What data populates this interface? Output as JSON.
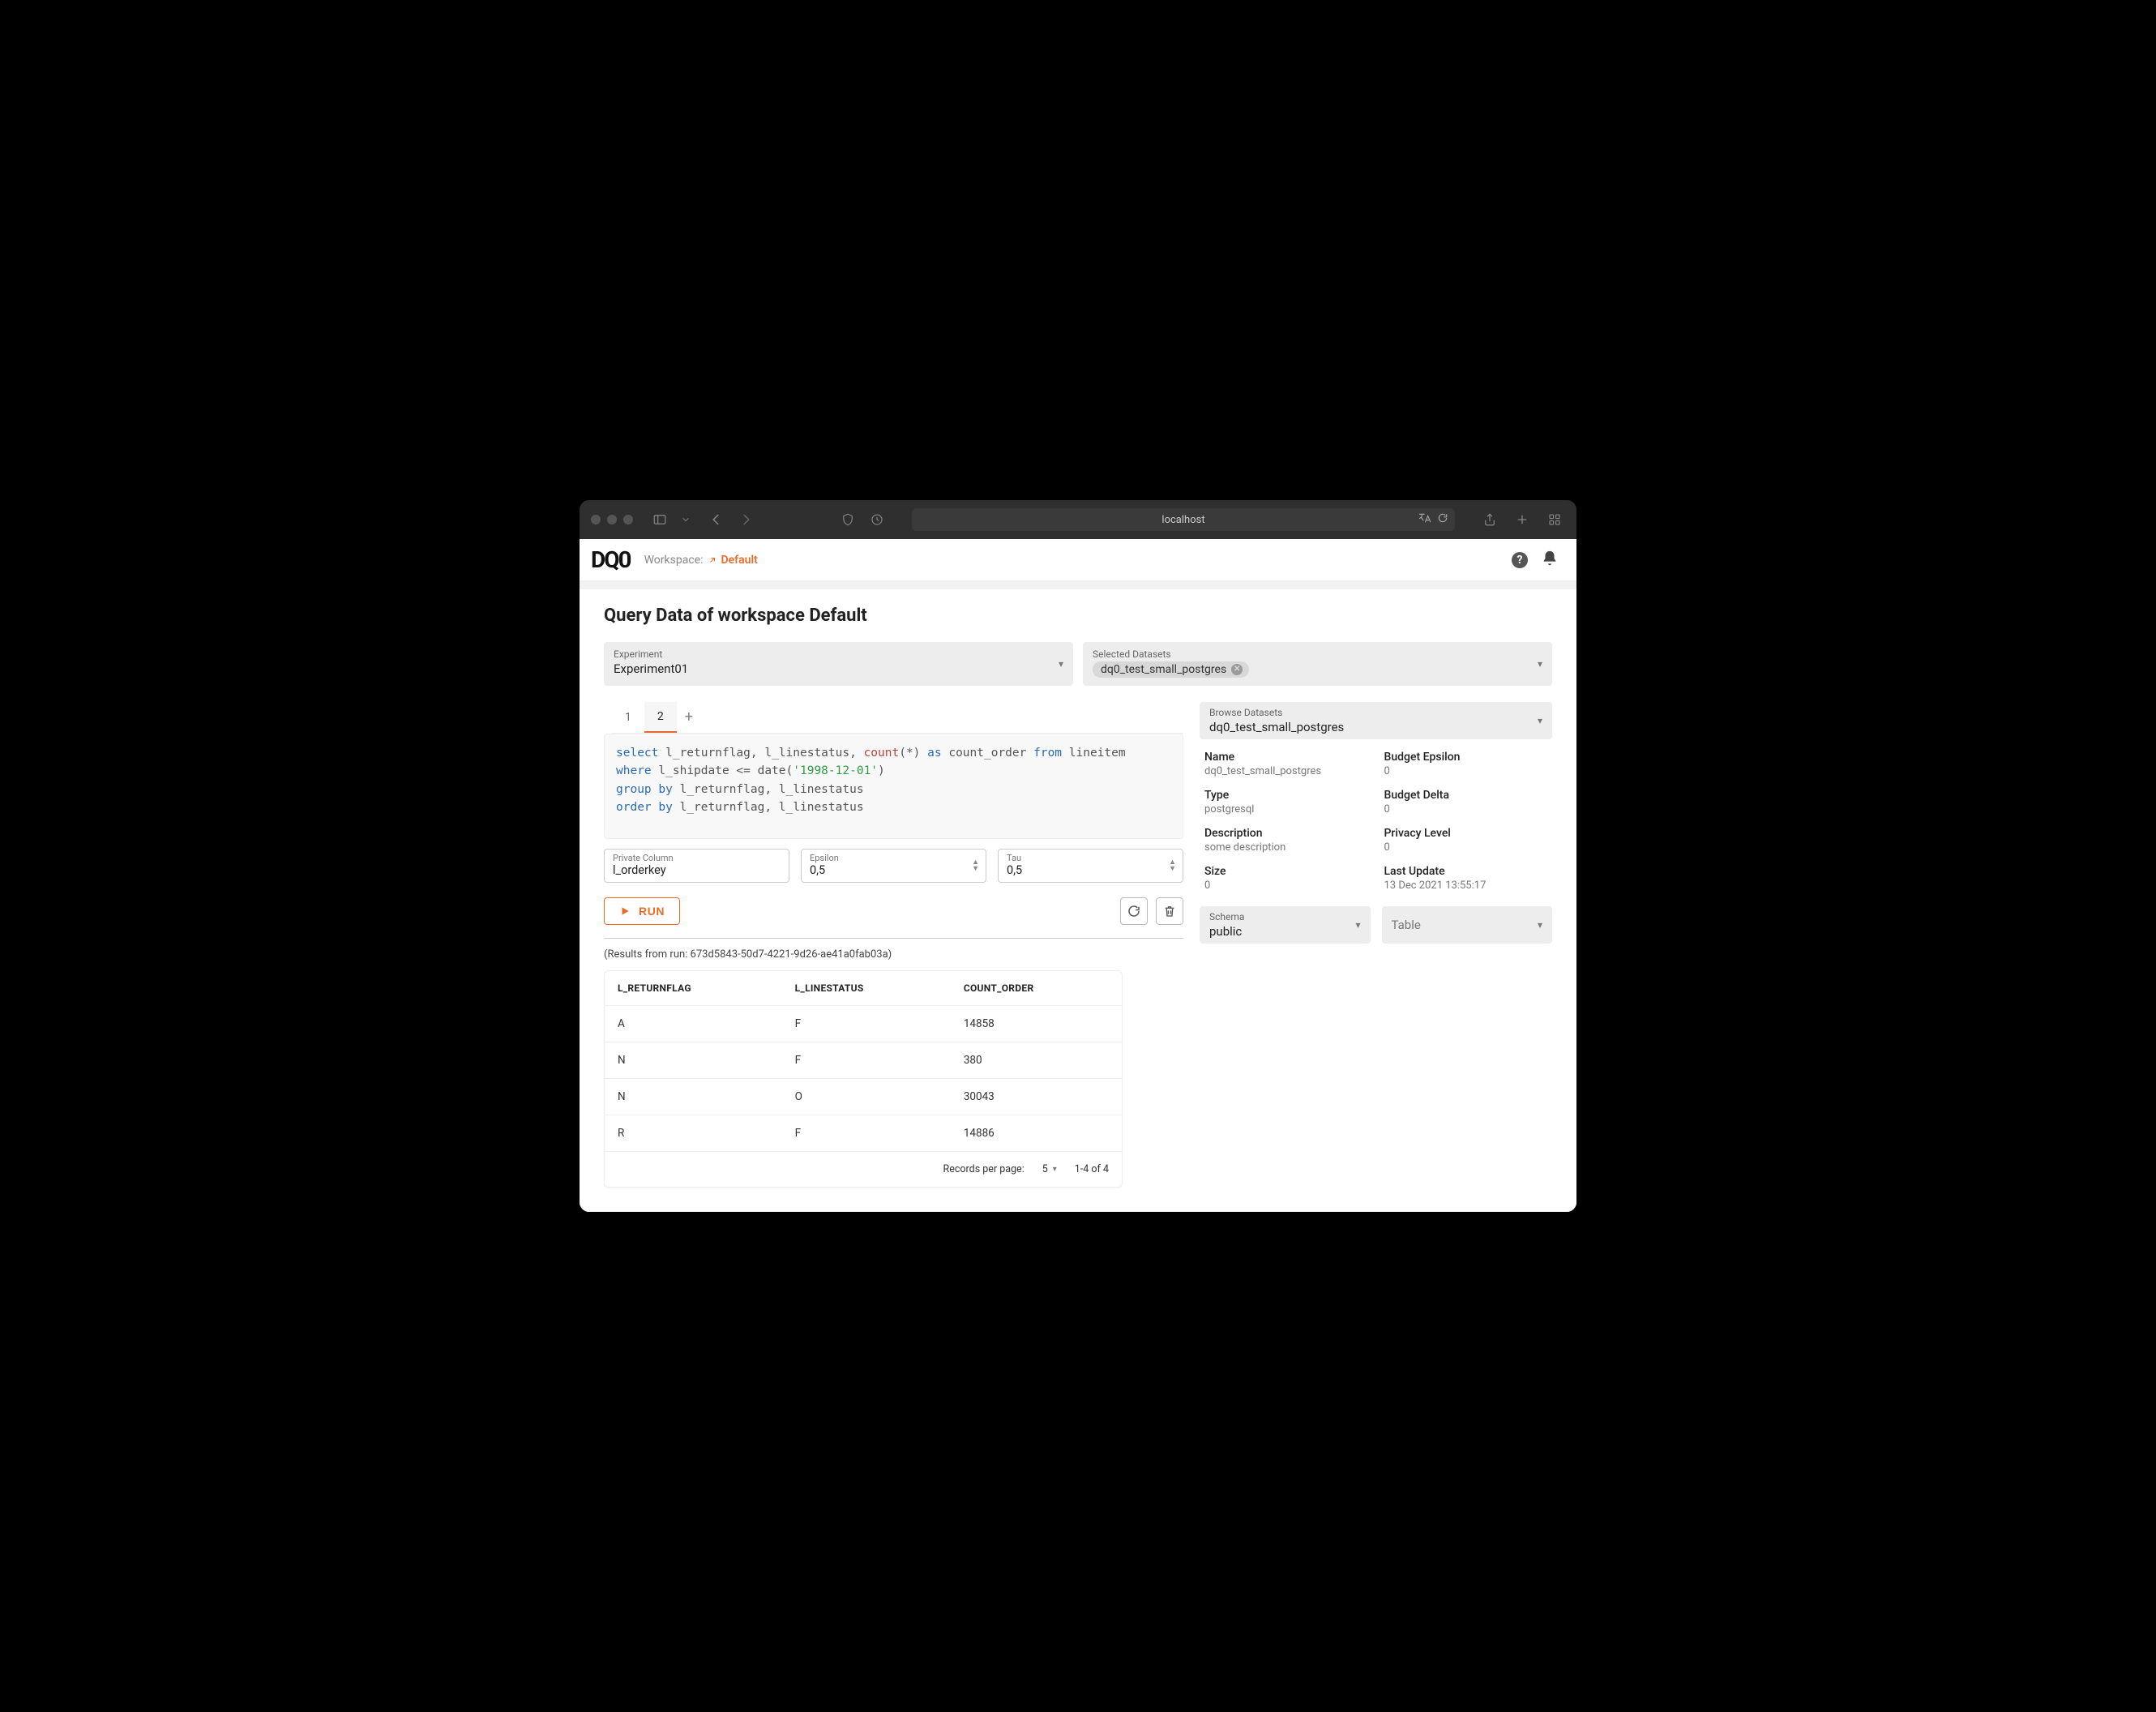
{
  "browser": {
    "url_display": "localhost"
  },
  "header": {
    "logo": "DQ0",
    "workspace_label": "Workspace:",
    "workspace_name": "Default"
  },
  "page": {
    "title": "Query Data of workspace Default",
    "experiment_label": "Experiment",
    "experiment_value": "Experiment01",
    "datasets_label": "Selected Datasets",
    "dataset_chip": "dq0_test_small_postgres"
  },
  "tabs": [
    "1",
    "2"
  ],
  "active_tab_index": 1,
  "sql_tokens": [
    {
      "t": "kw",
      "v": "select"
    },
    {
      "t": "",
      "v": " l_returnflag, l_linestatus, "
    },
    {
      "t": "fn",
      "v": "count"
    },
    {
      "t": "",
      "v": "(*) "
    },
    {
      "t": "kw",
      "v": "as"
    },
    {
      "t": "",
      "v": " count_order "
    },
    {
      "t": "kw",
      "v": "from"
    },
    {
      "t": "",
      "v": " lineitem"
    },
    {
      "t": "nl",
      "v": ""
    },
    {
      "t": "kw",
      "v": "where"
    },
    {
      "t": "",
      "v": " l_shipdate <= date("
    },
    {
      "t": "str",
      "v": "'1998-12-01'"
    },
    {
      "t": "",
      "v": ")"
    },
    {
      "t": "nl",
      "v": ""
    },
    {
      "t": "kw",
      "v": "group"
    },
    {
      "t": "",
      "v": " "
    },
    {
      "t": "kw",
      "v": "by"
    },
    {
      "t": "",
      "v": " l_returnflag, l_linestatus"
    },
    {
      "t": "nl",
      "v": ""
    },
    {
      "t": "kw",
      "v": "order"
    },
    {
      "t": "",
      "v": " "
    },
    {
      "t": "kw",
      "v": "by"
    },
    {
      "t": "",
      "v": " l_returnflag, l_linestatus"
    }
  ],
  "params": {
    "private_col_label": "Private Column",
    "private_col_value": "l_orderkey",
    "epsilon_label": "Epsilon",
    "epsilon_value": "0,5",
    "tau_label": "Tau",
    "tau_value": "0,5"
  },
  "run_label": "RUN",
  "results_caption_prefix": "(Results from run: ",
  "results_run_id": "673d5843-50d7-4221-9d26-ae41a0fab03a",
  "results_caption_suffix": ")",
  "results": {
    "columns": [
      "L_RETURNFLAG",
      "L_LINESTATUS",
      "COUNT_ORDER"
    ],
    "rows": [
      [
        "A",
        "F",
        "14858"
      ],
      [
        "N",
        "F",
        "380"
      ],
      [
        "N",
        "O",
        "30043"
      ],
      [
        "R",
        "F",
        "14886"
      ]
    ],
    "footer": {
      "rpp_label": "Records per page:",
      "rpp_value": "5",
      "range": "1-4 of 4"
    }
  },
  "browse": {
    "label": "Browse Datasets",
    "value": "dq0_test_small_postgres",
    "meta": {
      "name_label": "Name",
      "name_value": "dq0_test_small_postgres",
      "budget_eps_label": "Budget Epsilon",
      "budget_eps_value": "0",
      "type_label": "Type",
      "type_value": "postgresql",
      "budget_delta_label": "Budget Delta",
      "budget_delta_value": "0",
      "desc_label": "Description",
      "desc_value": "some description",
      "privacy_label": "Privacy Level",
      "privacy_value": "0",
      "size_label": "Size",
      "size_value": "0",
      "update_label": "Last Update",
      "update_value": "13 Dec 2021 13:55:17"
    },
    "schema_label": "Schema",
    "schema_value": "public",
    "table_label": "Table"
  }
}
